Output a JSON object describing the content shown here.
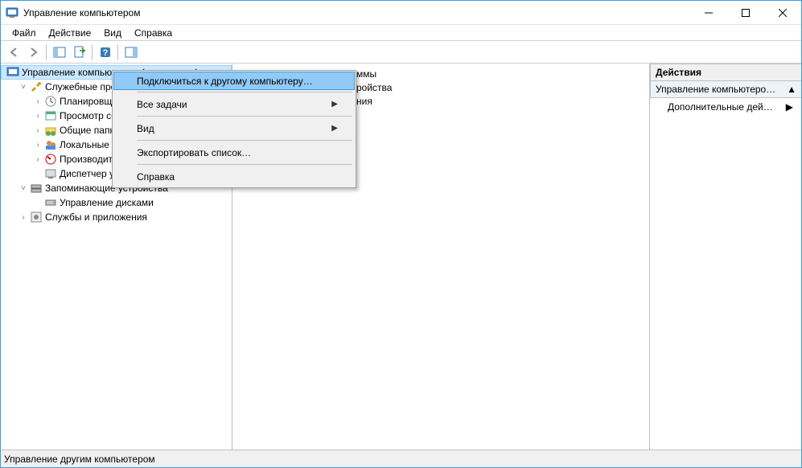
{
  "window": {
    "title": "Управление компьютером"
  },
  "menubar": {
    "file": "Файл",
    "action": "Действие",
    "view": "Вид",
    "help": "Справка"
  },
  "tree": {
    "root": "Управление компьютером (локальным)",
    "system_tools": "Служебные программы",
    "task_scheduler": "Планировщик заданий",
    "event_viewer": "Просмотр событий",
    "shared_folders": "Общие папки",
    "local_users": "Локальные пользователи и группы",
    "performance": "Производительность",
    "device_manager": "Диспетчер устройств",
    "storage": "Запоминающие устройства",
    "disk_management": "Управление дисками",
    "services_apps": "Службы и приложения"
  },
  "list": {
    "item1_frag": "ммы",
    "item2_frag": "ройства",
    "item3_frag": "ния"
  },
  "actions": {
    "header": "Действия",
    "sub": "Управление компьютеро…",
    "more": "Дополнительные дей…"
  },
  "context_menu": {
    "connect": "Подключиться к другому компьютеру…",
    "all_tasks": "Все задачи",
    "view": "Вид",
    "export_list": "Экспортировать список…",
    "help": "Справка"
  },
  "statusbar": {
    "text": "Управление другим компьютером"
  }
}
